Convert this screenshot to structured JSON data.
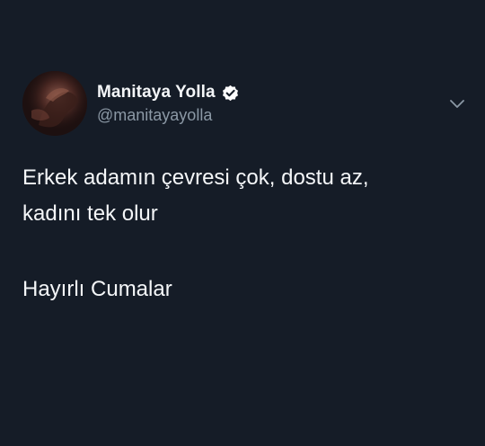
{
  "author": {
    "display_name": "Manitaya Yolla",
    "handle": "@manitayayolla",
    "verified": true,
    "avatar_icon": "profile-photo"
  },
  "menu": {
    "icon": "chevron-down-icon"
  },
  "tweet": {
    "lines": [
      "Erkek adamın çevresi çok, dostu az,",
      "kadını tek olur",
      "Hayırlı Cumalar"
    ]
  },
  "colors": {
    "background": "#151c27",
    "text": "#f4f6f8",
    "secondary_text": "#8b98a5",
    "verified_badge": "#ffffff"
  }
}
